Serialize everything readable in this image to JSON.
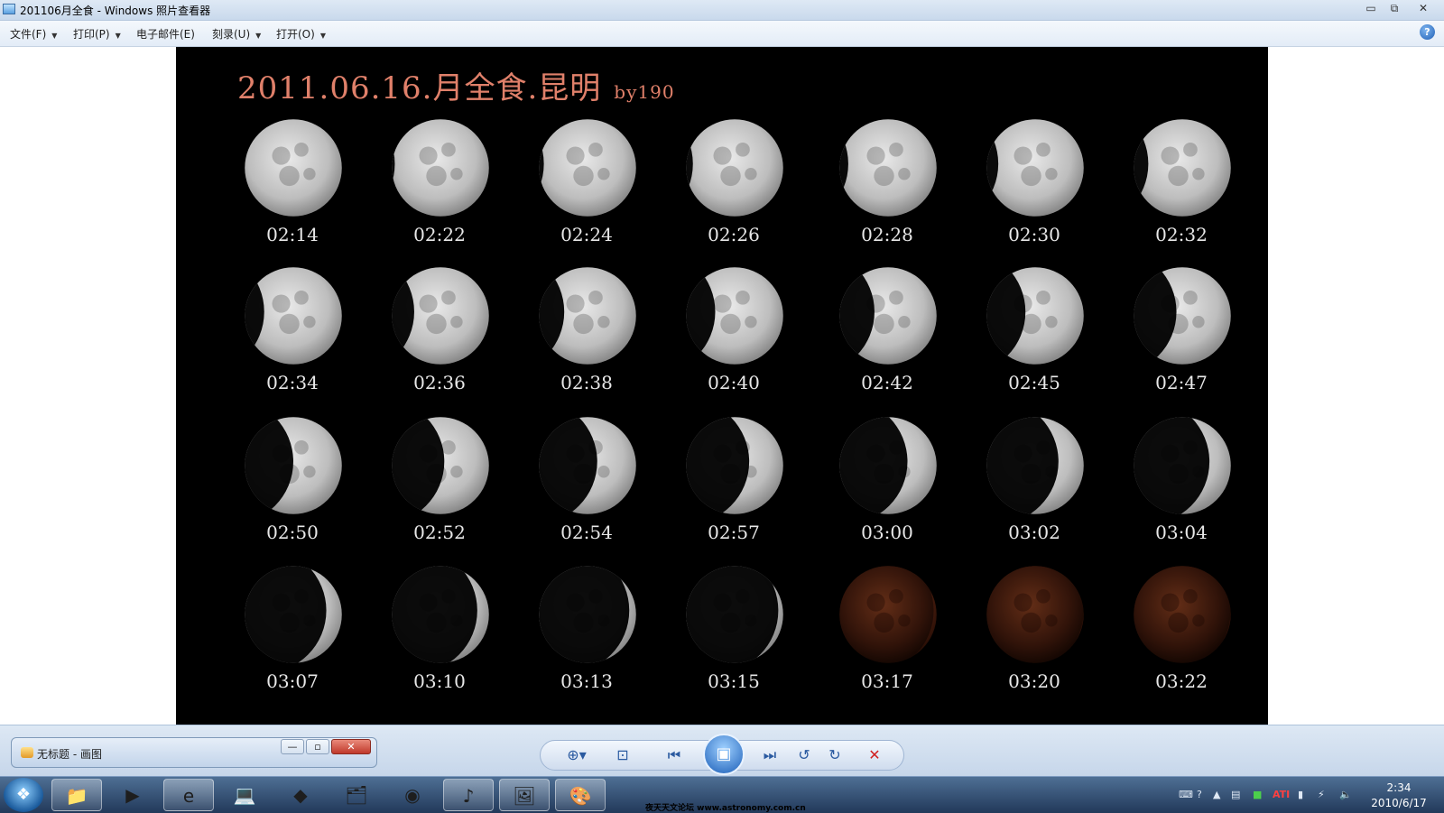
{
  "window": {
    "title": "201106月全食 - Windows 照片查看器",
    "minimize": "▭",
    "restore": "⧉",
    "close": "✕"
  },
  "menu": {
    "items": [
      {
        "label": "文件(F)",
        "has_arrow": true
      },
      {
        "label": "打印(P)",
        "has_arrow": true
      },
      {
        "label": "电子邮件(E)",
        "has_arrow": false
      },
      {
        "label": "刻录(U)",
        "has_arrow": true
      },
      {
        "label": "打开(O)",
        "has_arrow": true
      }
    ],
    "help_glyph": "?"
  },
  "photo": {
    "title_main": "2011.06.16.月全食.昆明",
    "title_by": "by190",
    "moons": [
      {
        "time": "02:14",
        "lit": 1.0,
        "red": false
      },
      {
        "time": "02:22",
        "lit": 0.97,
        "red": false
      },
      {
        "time": "02:24",
        "lit": 0.95,
        "red": false
      },
      {
        "time": "02:26",
        "lit": 0.93,
        "red": false
      },
      {
        "time": "02:28",
        "lit": 0.91,
        "red": false
      },
      {
        "time": "02:30",
        "lit": 0.88,
        "red": false
      },
      {
        "time": "02:32",
        "lit": 0.85,
        "red": false
      },
      {
        "time": "02:34",
        "lit": 0.8,
        "red": false
      },
      {
        "time": "02:36",
        "lit": 0.77,
        "red": false
      },
      {
        "time": "02:38",
        "lit": 0.74,
        "red": false
      },
      {
        "time": "02:40",
        "lit": 0.7,
        "red": false
      },
      {
        "time": "02:42",
        "lit": 0.64,
        "red": false
      },
      {
        "time": "02:45",
        "lit": 0.6,
        "red": false
      },
      {
        "time": "02:47",
        "lit": 0.56,
        "red": false
      },
      {
        "time": "02:50",
        "lit": 0.5,
        "red": false
      },
      {
        "time": "02:52",
        "lit": 0.46,
        "red": false
      },
      {
        "time": "02:54",
        "lit": 0.4,
        "red": false
      },
      {
        "time": "02:57",
        "lit": 0.35,
        "red": false
      },
      {
        "time": "03:00",
        "lit": 0.3,
        "red": false
      },
      {
        "time": "03:02",
        "lit": 0.26,
        "red": false
      },
      {
        "time": "03:04",
        "lit": 0.22,
        "red": false
      },
      {
        "time": "03:07",
        "lit": 0.16,
        "red": false
      },
      {
        "time": "03:10",
        "lit": 0.12,
        "red": false
      },
      {
        "time": "03:13",
        "lit": 0.07,
        "red": false
      },
      {
        "time": "03:15",
        "lit": 0.05,
        "red": false
      },
      {
        "time": "03:17",
        "lit": 0.03,
        "red": true
      },
      {
        "time": "03:20",
        "lit": 0.0,
        "red": true
      },
      {
        "time": "03:22",
        "lit": 0.0,
        "red": true
      }
    ]
  },
  "controls": {
    "zoom": "⊕▾",
    "fit": "⊡",
    "previous": "⏮",
    "slideshow": "▣",
    "next": "⏭",
    "rotate_ccw": "↺",
    "rotate_cw": "↻",
    "delete": "✕"
  },
  "paint_window": {
    "title": "无标题 - 画图",
    "minimize": "—",
    "restore": "▫",
    "close": "✕"
  },
  "taskbar": {
    "start_glyph": "❖",
    "apps": [
      {
        "name": "explorer",
        "glyph": "📁",
        "active": true
      },
      {
        "name": "media-player",
        "glyph": "▶",
        "active": false
      },
      {
        "name": "internet-explorer",
        "glyph": "e",
        "active": true
      },
      {
        "name": "computer",
        "glyph": "💻",
        "active": false
      },
      {
        "name": "app-red",
        "glyph": "◆",
        "active": false
      },
      {
        "name": "folder-2",
        "glyph": "🗂",
        "active": false
      },
      {
        "name": "media-orange",
        "glyph": "◉",
        "active": false
      },
      {
        "name": "itunes",
        "glyph": "♪",
        "active": true
      },
      {
        "name": "photo-viewer",
        "glyph": "🖼",
        "active": true
      },
      {
        "name": "paint",
        "glyph": "🎨",
        "active": true
      }
    ],
    "watermark": "夜天天文论坛 www.astronomy.com.cn",
    "clock_time": "2:34",
    "clock_date": "2010/6/17"
  }
}
